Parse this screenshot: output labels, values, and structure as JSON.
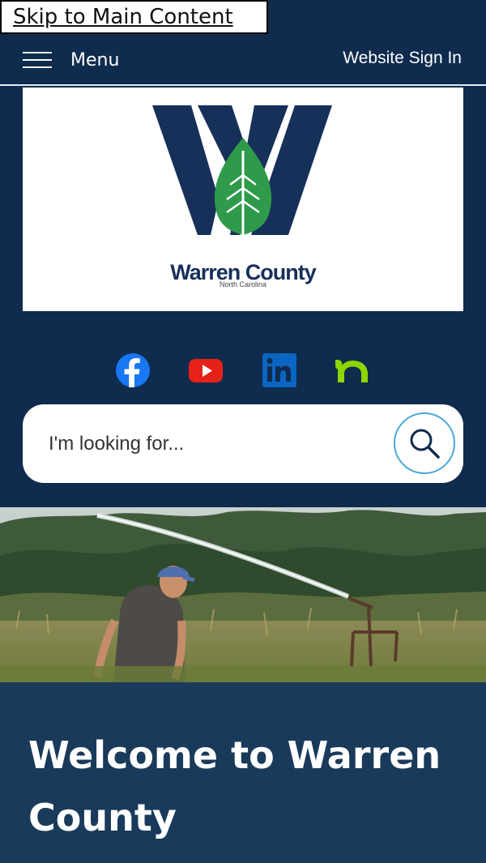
{
  "skip_link": "Skip to Main Content",
  "header": {
    "menu_label": "Menu",
    "signin_label": "Website Sign In"
  },
  "logo": {
    "title": "Warren County",
    "subtitle": "North Carolina"
  },
  "social": {
    "items": [
      {
        "icon": "facebook-icon",
        "color": "#1877f2"
      },
      {
        "icon": "youtube-icon",
        "color": "#e62117"
      },
      {
        "icon": "linkedin-icon",
        "color": "#0a66c2"
      },
      {
        "icon": "nextdoor-icon",
        "color": "#8ed500"
      }
    ]
  },
  "search": {
    "placeholder": "I'm looking for...",
    "button_icon": "search-icon"
  },
  "welcome": {
    "heading": "Welcome to Warren County"
  },
  "colors": {
    "navy": "#0f2b4d",
    "welcome_bg": "#193a5a",
    "leaf_green": "#2e9a4a",
    "search_border": "#4aa7d8"
  }
}
